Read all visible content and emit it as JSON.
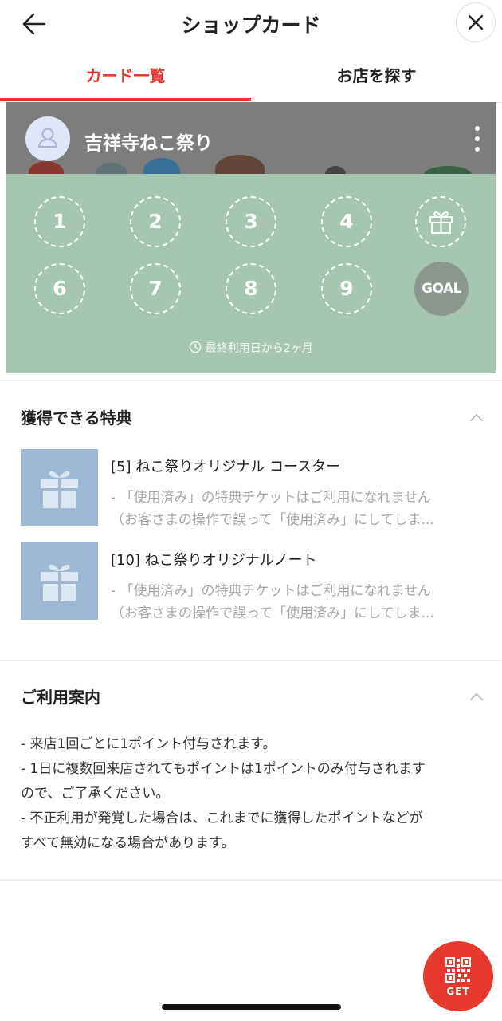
{
  "header": {
    "title": "ショップカード",
    "back_icon": "arrow-left-icon",
    "close_icon": "close-icon"
  },
  "tabs": [
    {
      "label": "カード一覧",
      "active": true
    },
    {
      "label": "お店を探す",
      "active": false
    }
  ],
  "card": {
    "shop_name": "吉祥寺ねこ祭り",
    "stamps": [
      "1",
      "2",
      "3",
      "4",
      "6",
      "7",
      "8",
      "9"
    ],
    "reward_icon": "gift-icon",
    "goal_label": "GOAL",
    "last_use": "最終利用日から2ヶ月",
    "colors": {
      "card_bg": "#a7c6b2",
      "header_bg": "#7d7d7d"
    }
  },
  "rewards_section": {
    "title": "獲得できる特典",
    "items": [
      {
        "title": "[5] ねこ祭りオリジナル コースター",
        "desc_line1": "- 「使用済み」の特典チケットはご利用になれません",
        "desc_line2": "（お客さまの操作で誤って「使用済み」にしてしま..."
      },
      {
        "title": "[10] ねこ祭りオリジナルノート",
        "desc_line1": "- 「使用済み」の特典チケットはご利用になれません",
        "desc_line2": "（お客さまの操作で誤って「使用済み」にしてしま..."
      }
    ]
  },
  "guide_section": {
    "title": "ご利用案内",
    "lines": [
      "- 来店1回ごとに1ポイント付与されます。",
      "- 1日に複数回来店されてもポイントは1ポイントのみ付与されます",
      "ので、ご了承ください。",
      "- 不正利用が発覚した場合は、これまでに獲得したポイントなどが",
      "すべて無効になる場合があります。"
    ]
  },
  "get_button": {
    "label": "GET",
    "icon": "qr-code-icon",
    "color": "#e5392e"
  },
  "accent_color": "#e5322d"
}
